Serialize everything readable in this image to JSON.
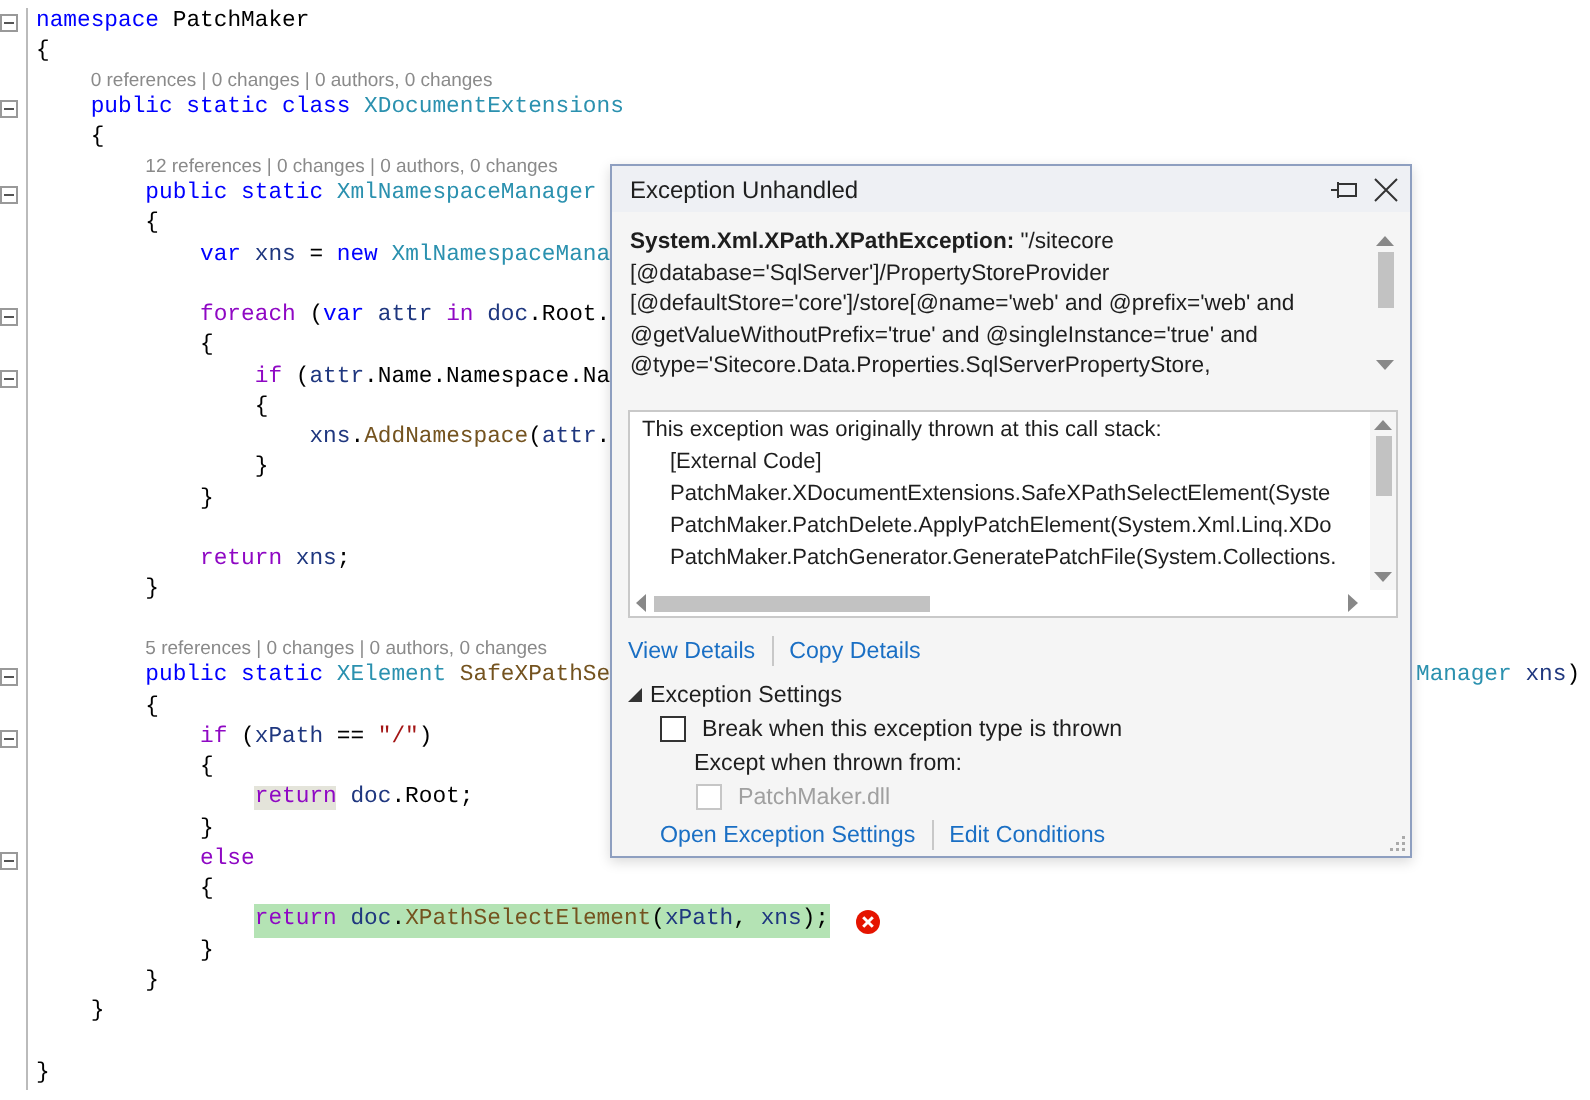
{
  "editor": {
    "lines": [
      {
        "kind": "code",
        "fold": true,
        "current": false,
        "error": false,
        "tokens": [
          {
            "text": "namespace",
            "kind": "keyword"
          },
          {
            "text": " PatchMaker",
            "kind": "plain"
          }
        ]
      },
      {
        "kind": "code",
        "fold": false,
        "current": false,
        "error": false,
        "tokens": [
          {
            "text": "{",
            "kind": "plain"
          }
        ],
        "children": [
          {
            "kind": "lens",
            "text": "0 references | 0 changes | 0 authors, 0 changes"
          },
          {
            "kind": "code",
            "fold": true,
            "current": false,
            "error": false,
            "tokens": [
              {
                "text": "public static class ",
                "kind": "keyword"
              },
              {
                "text": "XDocumentExtensions",
                "kind": "type"
              }
            ]
          },
          {
            "kind": "code",
            "fold": false,
            "current": false,
            "error": false,
            "tokens": [
              {
                "text": "{",
                "kind": "plain"
              }
            ],
            "children": [
              {
                "kind": "lens",
                "text": "12 references | 0 changes | 0 authors, 0 changes"
              },
              {
                "kind": "code",
                "fold": true,
                "current": false,
                "error": false,
                "tokens": [
                  {
                    "text": "public static ",
                    "kind": "keyword"
                  },
                  {
                    "text": "XmlNamespaceManager",
                    "kind": "type"
                  }
                ]
              },
              {
                "kind": "code",
                "fold": false,
                "current": false,
                "error": false,
                "tokens": [
                  {
                    "text": "{",
                    "kind": "plain"
                  }
                ],
                "children": [
                  {
                    "kind": "code",
                    "fold": false,
                    "current": false,
                    "tokens": [
                      {
                        "text": "var ",
                        "kind": "keyword"
                      },
                      {
                        "text": "xns",
                        "kind": "local"
                      },
                      {
                        "text": " = ",
                        "kind": "plain"
                      },
                      {
                        "text": "new ",
                        "kind": "keyword"
                      },
                      {
                        "text": "XmlNamespaceMana",
                        "kind": "type"
                      }
                    ]
                  },
                  {
                    "kind": "blank"
                  },
                  {
                    "kind": "code",
                    "fold": true,
                    "current": false,
                    "error": false,
                    "tokens": [
                      {
                        "text": "foreach",
                        "kind": "control"
                      },
                      {
                        "text": " (",
                        "kind": "plain"
                      },
                      {
                        "text": "var ",
                        "kind": "keyword"
                      },
                      {
                        "text": "attr",
                        "kind": "local"
                      },
                      {
                        "text": " in ",
                        "kind": "control"
                      },
                      {
                        "text": "doc",
                        "kind": "local"
                      },
                      {
                        "text": ".Root.",
                        "kind": "plain"
                      }
                    ]
                  },
                  {
                    "kind": "code",
                    "fold": false,
                    "current": false,
                    "error": false,
                    "tokens": [
                      {
                        "text": "{",
                        "kind": "plain"
                      }
                    ],
                    "children": [
                      {
                        "kind": "code",
                        "fold": true,
                        "current": false,
                        "error": false,
                        "tokens": [
                          {
                            "text": "if",
                            "kind": "control"
                          },
                          {
                            "text": " (",
                            "kind": "plain"
                          },
                          {
                            "text": "attr",
                            "kind": "local"
                          },
                          {
                            "text": ".Name.Namespace.Na",
                            "kind": "plain"
                          }
                        ]
                      },
                      {
                        "kind": "code",
                        "fold": false,
                        "current": false,
                        "error": false,
                        "tokens": [
                          {
                            "text": "{",
                            "kind": "plain"
                          }
                        ],
                        "children": [
                          {
                            "kind": "code",
                            "fold": false,
                            "current": false,
                            "tokens": [
                              {
                                "text": "xns",
                                "kind": "local"
                              },
                              {
                                "text": ".",
                                "kind": "plain"
                              },
                              {
                                "text": "AddNamespace",
                                "kind": "method"
                              },
                              {
                                "text": "(",
                                "kind": "plain"
                              },
                              {
                                "text": "attr",
                                "kind": "local"
                              },
                              {
                                "text": ".",
                                "kind": "plain"
                              }
                            ]
                          }
                        ]
                      },
                      {
                        "kind": "code",
                        "fold": false,
                        "current": false,
                        "error": false,
                        "tokens": [
                          {
                            "text": "}",
                            "kind": "plain"
                          }
                        ]
                      }
                    ]
                  },
                  {
                    "kind": "code",
                    "fold": false,
                    "current": false,
                    "error": false,
                    "tokens": [
                      {
                        "text": "}",
                        "kind": "plain"
                      }
                    ]
                  },
                  {
                    "kind": "blank"
                  },
                  {
                    "kind": "code",
                    "fold": false,
                    "current": false,
                    "error": false,
                    "tokens": [
                      {
                        "text": "return ",
                        "kind": "control"
                      },
                      {
                        "text": "xns",
                        "kind": "local"
                      },
                      {
                        "text": ";",
                        "kind": "plain"
                      }
                    ]
                  }
                ]
              },
              {
                "kind": "code",
                "fold": false,
                "current": false,
                "error": false,
                "tokens": [
                  {
                    "text": "}",
                    "kind": "plain"
                  }
                ]
              },
              {
                "kind": "blank"
              },
              {
                "kind": "lens",
                "text": "5 references | 0 changes | 0 authors, 0 changes"
              },
              {
                "kind": "code",
                "fold": true,
                "current": false,
                "error": false,
                "tokens": [
                  {
                    "text": "public static ",
                    "kind": "keyword"
                  },
                  {
                    "text": "XElement ",
                    "kind": "type"
                  },
                  {
                    "text": "SafeXPathSe",
                    "kind": "method"
                  }
                ],
                "tail": [
                  {
                    "text": "Manager ",
                    "kind": "type"
                  },
                  {
                    "text": "xns",
                    "kind": "local"
                  },
                  {
                    "text": ")",
                    "kind": "plain"
                  }
                ]
              },
              {
                "kind": "code",
                "fold": false,
                "current": false,
                "error": false,
                "tokens": [
                  {
                    "text": "{",
                    "kind": "plain"
                  }
                ],
                "children": [
                  {
                    "kind": "code",
                    "fold": true,
                    "current": false,
                    "error": false,
                    "tokens": [
                      {
                        "text": "if",
                        "kind": "control"
                      },
                      {
                        "text": " (",
                        "kind": "plain"
                      },
                      {
                        "text": "xPath",
                        "kind": "local"
                      },
                      {
                        "text": " == ",
                        "kind": "plain"
                      },
                      {
                        "text": "\"/\"",
                        "kind": "string"
                      },
                      {
                        "text": ")",
                        "kind": "plain"
                      }
                    ]
                  },
                  {
                    "kind": "code",
                    "fold": false,
                    "current": false,
                    "error": false,
                    "tokens": [
                      {
                        "text": "{",
                        "kind": "plain"
                      }
                    ],
                    "children": [
                      {
                        "kind": "code",
                        "fold": false,
                        "current": false,
                        "error": false,
                        "tokens": [
                          {
                            "text": "return",
                            "kind": "reference"
                          },
                          {
                            "text": " doc",
                            "kind": "local"
                          },
                          {
                            "text": ".Root;",
                            "kind": "plain"
                          }
                        ]
                      }
                    ]
                  },
                  {
                    "kind": "code",
                    "fold": false,
                    "current": false,
                    "error": false,
                    "tokens": [
                      {
                        "text": "}",
                        "kind": "plain"
                      }
                    ]
                  },
                  {
                    "kind": "code",
                    "fold": true,
                    "current": false,
                    "error": false,
                    "tokens": [
                      {
                        "text": "else",
                        "kind": "control"
                      }
                    ]
                  },
                  {
                    "kind": "code",
                    "fold": false,
                    "current": false,
                    "error": false,
                    "tokens": [
                      {
                        "text": "{",
                        "kind": "plain"
                      }
                    ],
                    "children": [
                      {
                        "kind": "code",
                        "fold": false,
                        "current": true,
                        "error": true,
                        "tokens": [
                          {
                            "text": "return ",
                            "kind": "control"
                          },
                          {
                            "text": "doc",
                            "kind": "local"
                          },
                          {
                            "text": ".",
                            "kind": "plain"
                          },
                          {
                            "text": "XPathSelectElement",
                            "kind": "method"
                          },
                          {
                            "text": "(",
                            "kind": "plain"
                          },
                          {
                            "text": "xPath",
                            "kind": "local"
                          },
                          {
                            "text": ", ",
                            "kind": "plain"
                          },
                          {
                            "text": "xns",
                            "kind": "local"
                          },
                          {
                            "text": ");",
                            "kind": "plain"
                          }
                        ]
                      }
                    ]
                  },
                  {
                    "kind": "code",
                    "fold": false,
                    "current": false,
                    "error": false,
                    "tokens": [
                      {
                        "text": "}",
                        "kind": "plain"
                      }
                    ]
                  }
                ]
              },
              {
                "kind": "code",
                "fold": false,
                "current": false,
                "error": false,
                "tokens": [
                  {
                    "text": "}",
                    "kind": "plain"
                  }
                ]
              }
            ]
          },
          {
            "kind": "code",
            "fold": false,
            "current": false,
            "error": false,
            "tokens": [
              {
                "text": "}",
                "kind": "plain"
              }
            ]
          },
          {
            "kind": "blank"
          }
        ]
      },
      {
        "kind": "code",
        "fold": false,
        "current": false,
        "error": false,
        "tokens": [
          {
            "text": "}",
            "kind": "plain"
          }
        ]
      }
    ]
  },
  "exception_popup": {
    "title": "Exception Unhandled",
    "message": "**System.Xml.XPath.XPathException:** \"/sitecore [@database='SqlServer']/PropertyStoreProvider [@defaultStore='core']/store[@name='web' and @prefix='web' and @getValueWithoutPrefix='true' and @singleInstance='true' and @type='Sitecore.Data.Properties.SqlServerPropertyStore,",
    "call_stack": {
      "heading": "This exception was originally thrown at this call stack:",
      "frames": [
        "[External Code]",
        "PatchMaker.XDocumentExtensions.SafeXPathSelectElement(Syste",
        "PatchMaker.PatchDelete.ApplyPatchElement(System.Xml.Linq.XDo",
        "PatchMaker.PatchGenerator.GeneratePatchFile(System.Collections."
      ]
    },
    "links": [
      "View Details",
      "Copy Details"
    ],
    "settings": {
      "label": "Exception Settings",
      "expanded": true,
      "break_option": {
        "label": "Break when this exception type is thrown",
        "checked": false
      },
      "except_label": "Except when thrown from:",
      "module_option": {
        "label": "PatchMaker.dll",
        "checked": false,
        "disabled": true
      },
      "links": [
        "Open Exception Settings",
        "Edit Conditions"
      ]
    }
  }
}
